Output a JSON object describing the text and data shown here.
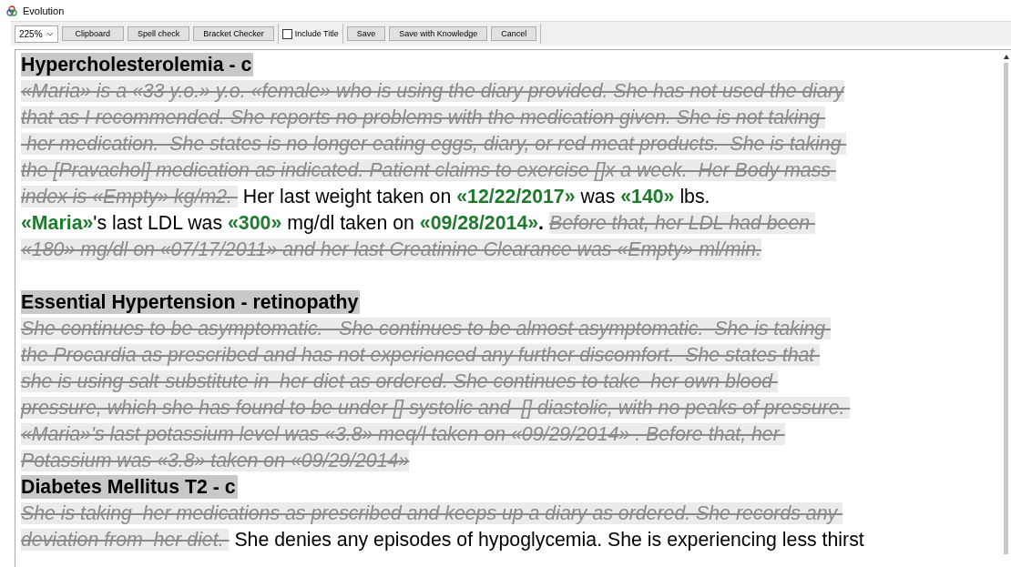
{
  "window": {
    "title": "Evolution"
  },
  "toolbar": {
    "zoom": "225%",
    "buttons_left": [
      "Clipboard",
      "Spell check",
      "Bracket Checker"
    ],
    "include_title": {
      "label": "Include Title",
      "checked": false
    },
    "buttons_right": [
      "Save",
      "Save with Knowledge",
      "Cancel"
    ]
  },
  "sections": [
    {
      "heading": "Hypercholesterolemia - c",
      "lines": [
        [
          {
            "kind": "struck",
            "text": "«Maria» is a «33 y.o.» y.o. «female» who is using the diary provided. She has not used the diary"
          }
        ],
        [
          {
            "kind": "struck",
            "text": "that as I recommended. She reports no problems with the medication given. She is not taking "
          }
        ],
        [
          {
            "kind": "struck",
            "text": " her medication.  She states is no longer eating eggs, diary, or red meat products.  She is taking "
          }
        ],
        [
          {
            "kind": "struck",
            "text": "the [Pravachol] medication as indicated. Patient claims to exercise []x a week.  Her Body mass "
          }
        ],
        [
          {
            "kind": "struck",
            "text": "index is «Empty» kg/m2. "
          },
          {
            "kind": "plain",
            "text": " Her last weight taken on "
          },
          {
            "kind": "value",
            "text": "«12/22/2017»"
          },
          {
            "kind": "plain",
            "text": " was "
          },
          {
            "kind": "value",
            "text": "«140»"
          },
          {
            "kind": "plain",
            "text": " lbs."
          }
        ],
        [
          {
            "kind": "value",
            "text": "«Maria»"
          },
          {
            "kind": "plain",
            "text": "'s last LDL was "
          },
          {
            "kind": "value",
            "text": "«300»"
          },
          {
            "kind": "plain",
            "text": " mg/dl taken on "
          },
          {
            "kind": "value",
            "text": "«09/28/2014»"
          },
          {
            "kind": "bold",
            "text": ". "
          },
          {
            "kind": "struck",
            "text": "Before that, her LDL had been "
          }
        ],
        [
          {
            "kind": "struck",
            "text": "«180» mg/dl on «07/17/2011» and her last Creatinine Clearance was «Empty» ml/min."
          }
        ]
      ]
    },
    {
      "heading": "Essential Hypertension - retinopathy",
      "lines": [
        [
          {
            "kind": "struck",
            "text": "She continues to be asymptomatic.   She continues to be almost asymptomatic.  She is taking "
          }
        ],
        [
          {
            "kind": "struck",
            "text": "the Procardia as prescribed and has not experienced any further discomfort.  She states that "
          }
        ],
        [
          {
            "kind": "struck",
            "text": "she is using salt-substitute in  her diet as ordered. She continues to take  her own blood "
          }
        ],
        [
          {
            "kind": "struck",
            "text": "pressure, which she has found to be under [] systolic and  [] diastolic, with no peaks of pressure. "
          }
        ],
        [
          {
            "kind": "struck",
            "text": "«Maria»'s last potassium level was «3.8» meq/l taken on «09/29/2014» . Before that, her "
          }
        ],
        [
          {
            "kind": "struck",
            "text": "Potassium was «3.8» taken on «09/29/2014»"
          }
        ]
      ]
    },
    {
      "heading": "Diabetes Mellitus T2 - c",
      "lines": [
        [
          {
            "kind": "struck",
            "text": "She is taking  her medications as prescribed and keeps up a diary as ordered. She records any "
          }
        ],
        [
          {
            "kind": "struck",
            "text": "deviation from  her diet. "
          },
          {
            "kind": "plain",
            "text": " She denies any episodes of hypoglycemia. She is experiencing less thirst"
          }
        ]
      ]
    }
  ]
}
